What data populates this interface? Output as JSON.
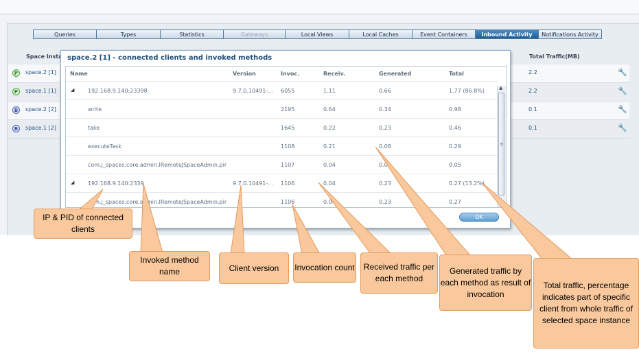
{
  "tabs": [
    {
      "label": "Queries",
      "state": "normal"
    },
    {
      "label": "Types",
      "state": "normal"
    },
    {
      "label": "Statistics",
      "state": "normal"
    },
    {
      "label": "Gateways",
      "state": "disabled"
    },
    {
      "label": "Local Views",
      "state": "normal"
    },
    {
      "label": "Local Caches",
      "state": "normal"
    },
    {
      "label": "Event Containers",
      "state": "normal"
    },
    {
      "label": "Inbound Activity",
      "state": "active"
    },
    {
      "label": "Notifications Activity",
      "state": "normal"
    }
  ],
  "background_table": {
    "header_space": "Space Insta",
    "header_traffic": "Total Traffic(MB)",
    "rows": [
      {
        "icon": "primary-icon",
        "icon_letter": "P",
        "name": "space.2 [1]",
        "traffic": "2.2"
      },
      {
        "icon": "primary-icon",
        "icon_letter": "P",
        "name": "space.1 [1]",
        "traffic": "2.2"
      },
      {
        "icon": "backup-icon",
        "icon_letter": "B",
        "name": "space.2 [2]",
        "traffic": "0.1"
      },
      {
        "icon": "backup-icon",
        "icon_letter": "B",
        "name": "space.1 [2]",
        "traffic": "0.1"
      }
    ],
    "action_icon": "wrench-icon"
  },
  "dialog": {
    "title": "space.2 [1] - connected clients and invoked methods",
    "columns": {
      "name": "Name",
      "version": "Version",
      "invoc": "Invoc.",
      "receiv": "Receiv.",
      "generated": "Generated",
      "total": "Total"
    },
    "rows": [
      {
        "expanded": true,
        "name": "192.168.9.140:23398",
        "version": "9.7.0.10491-...",
        "invoc": "6055",
        "receiv": "1.11",
        "generated": "0.66",
        "total": "1.77 (86.8%)"
      },
      {
        "expanded": null,
        "name": "write",
        "version": "",
        "invoc": "2195",
        "receiv": "0.64",
        "generated": "0.34",
        "total": "0.98"
      },
      {
        "expanded": null,
        "name": "take",
        "version": "",
        "invoc": "1645",
        "receiv": "0.22",
        "generated": "0.23",
        "total": "0.46"
      },
      {
        "expanded": null,
        "name": "executeTask",
        "version": "",
        "invoc": "1108",
        "receiv": "0.21",
        "generated": "0.08",
        "total": "0.29"
      },
      {
        "expanded": null,
        "name": "com.j_spaces.core.admin.IRemoteJSpaceAdmin.pir",
        "version": "",
        "invoc": "1107",
        "receiv": "0.04",
        "generated": "0.0",
        "total": "0.05"
      },
      {
        "expanded": true,
        "name": "192.168.9.140:2339",
        "version": "9.7.0.10491-...",
        "invoc": "1106",
        "receiv": "0.04",
        "generated": "0.23",
        "total": "0.27 (13.2%)"
      },
      {
        "expanded": null,
        "name": "com.j_spaces.core.admin.IRemoteJSpaceAdmin.pir",
        "version": "",
        "invoc": "1106",
        "receiv": "0.04",
        "generated": "0.23",
        "total": "0.27"
      }
    ],
    "ok_label": "OK"
  },
  "callouts": {
    "ip_pid": "IP & PID of connected clients",
    "method": "Invoked method name",
    "version": "Client version",
    "invocation": "Invocation count",
    "received": "Received traffic per each method",
    "generated": "Generated traffic by each method as result of invocation",
    "total": "Total traffic, percentage indicates part of specific client from whole traffic of selected space instance"
  },
  "colors": {
    "callout_fill": "#f9c89c",
    "callout_border": "#e29a5f",
    "active_tab": "#1e5c95",
    "link_text": "#1e4f80"
  }
}
